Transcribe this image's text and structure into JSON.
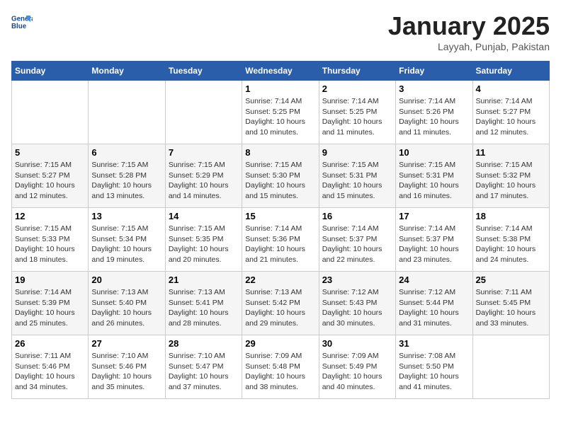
{
  "header": {
    "logo_line1": "General",
    "logo_line2": "Blue",
    "month_title": "January 2025",
    "location": "Layyah, Punjab, Pakistan"
  },
  "weekdays": [
    "Sunday",
    "Monday",
    "Tuesday",
    "Wednesday",
    "Thursday",
    "Friday",
    "Saturday"
  ],
  "weeks": [
    [
      {
        "day": "",
        "sunrise": "",
        "sunset": "",
        "daylight": ""
      },
      {
        "day": "",
        "sunrise": "",
        "sunset": "",
        "daylight": ""
      },
      {
        "day": "",
        "sunrise": "",
        "sunset": "",
        "daylight": ""
      },
      {
        "day": "1",
        "sunrise": "Sunrise: 7:14 AM",
        "sunset": "Sunset: 5:25 PM",
        "daylight": "Daylight: 10 hours and 10 minutes."
      },
      {
        "day": "2",
        "sunrise": "Sunrise: 7:14 AM",
        "sunset": "Sunset: 5:25 PM",
        "daylight": "Daylight: 10 hours and 11 minutes."
      },
      {
        "day": "3",
        "sunrise": "Sunrise: 7:14 AM",
        "sunset": "Sunset: 5:26 PM",
        "daylight": "Daylight: 10 hours and 11 minutes."
      },
      {
        "day": "4",
        "sunrise": "Sunrise: 7:14 AM",
        "sunset": "Sunset: 5:27 PM",
        "daylight": "Daylight: 10 hours and 12 minutes."
      }
    ],
    [
      {
        "day": "5",
        "sunrise": "Sunrise: 7:15 AM",
        "sunset": "Sunset: 5:27 PM",
        "daylight": "Daylight: 10 hours and 12 minutes."
      },
      {
        "day": "6",
        "sunrise": "Sunrise: 7:15 AM",
        "sunset": "Sunset: 5:28 PM",
        "daylight": "Daylight: 10 hours and 13 minutes."
      },
      {
        "day": "7",
        "sunrise": "Sunrise: 7:15 AM",
        "sunset": "Sunset: 5:29 PM",
        "daylight": "Daylight: 10 hours and 14 minutes."
      },
      {
        "day": "8",
        "sunrise": "Sunrise: 7:15 AM",
        "sunset": "Sunset: 5:30 PM",
        "daylight": "Daylight: 10 hours and 15 minutes."
      },
      {
        "day": "9",
        "sunrise": "Sunrise: 7:15 AM",
        "sunset": "Sunset: 5:31 PM",
        "daylight": "Daylight: 10 hours and 15 minutes."
      },
      {
        "day": "10",
        "sunrise": "Sunrise: 7:15 AM",
        "sunset": "Sunset: 5:31 PM",
        "daylight": "Daylight: 10 hours and 16 minutes."
      },
      {
        "day": "11",
        "sunrise": "Sunrise: 7:15 AM",
        "sunset": "Sunset: 5:32 PM",
        "daylight": "Daylight: 10 hours and 17 minutes."
      }
    ],
    [
      {
        "day": "12",
        "sunrise": "Sunrise: 7:15 AM",
        "sunset": "Sunset: 5:33 PM",
        "daylight": "Daylight: 10 hours and 18 minutes."
      },
      {
        "day": "13",
        "sunrise": "Sunrise: 7:15 AM",
        "sunset": "Sunset: 5:34 PM",
        "daylight": "Daylight: 10 hours and 19 minutes."
      },
      {
        "day": "14",
        "sunrise": "Sunrise: 7:15 AM",
        "sunset": "Sunset: 5:35 PM",
        "daylight": "Daylight: 10 hours and 20 minutes."
      },
      {
        "day": "15",
        "sunrise": "Sunrise: 7:14 AM",
        "sunset": "Sunset: 5:36 PM",
        "daylight": "Daylight: 10 hours and 21 minutes."
      },
      {
        "day": "16",
        "sunrise": "Sunrise: 7:14 AM",
        "sunset": "Sunset: 5:37 PM",
        "daylight": "Daylight: 10 hours and 22 minutes."
      },
      {
        "day": "17",
        "sunrise": "Sunrise: 7:14 AM",
        "sunset": "Sunset: 5:37 PM",
        "daylight": "Daylight: 10 hours and 23 minutes."
      },
      {
        "day": "18",
        "sunrise": "Sunrise: 7:14 AM",
        "sunset": "Sunset: 5:38 PM",
        "daylight": "Daylight: 10 hours and 24 minutes."
      }
    ],
    [
      {
        "day": "19",
        "sunrise": "Sunrise: 7:14 AM",
        "sunset": "Sunset: 5:39 PM",
        "daylight": "Daylight: 10 hours and 25 minutes."
      },
      {
        "day": "20",
        "sunrise": "Sunrise: 7:13 AM",
        "sunset": "Sunset: 5:40 PM",
        "daylight": "Daylight: 10 hours and 26 minutes."
      },
      {
        "day": "21",
        "sunrise": "Sunrise: 7:13 AM",
        "sunset": "Sunset: 5:41 PM",
        "daylight": "Daylight: 10 hours and 28 minutes."
      },
      {
        "day": "22",
        "sunrise": "Sunrise: 7:13 AM",
        "sunset": "Sunset: 5:42 PM",
        "daylight": "Daylight: 10 hours and 29 minutes."
      },
      {
        "day": "23",
        "sunrise": "Sunrise: 7:12 AM",
        "sunset": "Sunset: 5:43 PM",
        "daylight": "Daylight: 10 hours and 30 minutes."
      },
      {
        "day": "24",
        "sunrise": "Sunrise: 7:12 AM",
        "sunset": "Sunset: 5:44 PM",
        "daylight": "Daylight: 10 hours and 31 minutes."
      },
      {
        "day": "25",
        "sunrise": "Sunrise: 7:11 AM",
        "sunset": "Sunset: 5:45 PM",
        "daylight": "Daylight: 10 hours and 33 minutes."
      }
    ],
    [
      {
        "day": "26",
        "sunrise": "Sunrise: 7:11 AM",
        "sunset": "Sunset: 5:46 PM",
        "daylight": "Daylight: 10 hours and 34 minutes."
      },
      {
        "day": "27",
        "sunrise": "Sunrise: 7:10 AM",
        "sunset": "Sunset: 5:46 PM",
        "daylight": "Daylight: 10 hours and 35 minutes."
      },
      {
        "day": "28",
        "sunrise": "Sunrise: 7:10 AM",
        "sunset": "Sunset: 5:47 PM",
        "daylight": "Daylight: 10 hours and 37 minutes."
      },
      {
        "day": "29",
        "sunrise": "Sunrise: 7:09 AM",
        "sunset": "Sunset: 5:48 PM",
        "daylight": "Daylight: 10 hours and 38 minutes."
      },
      {
        "day": "30",
        "sunrise": "Sunrise: 7:09 AM",
        "sunset": "Sunset: 5:49 PM",
        "daylight": "Daylight: 10 hours and 40 minutes."
      },
      {
        "day": "31",
        "sunrise": "Sunrise: 7:08 AM",
        "sunset": "Sunset: 5:50 PM",
        "daylight": "Daylight: 10 hours and 41 minutes."
      },
      {
        "day": "",
        "sunrise": "",
        "sunset": "",
        "daylight": ""
      }
    ]
  ]
}
